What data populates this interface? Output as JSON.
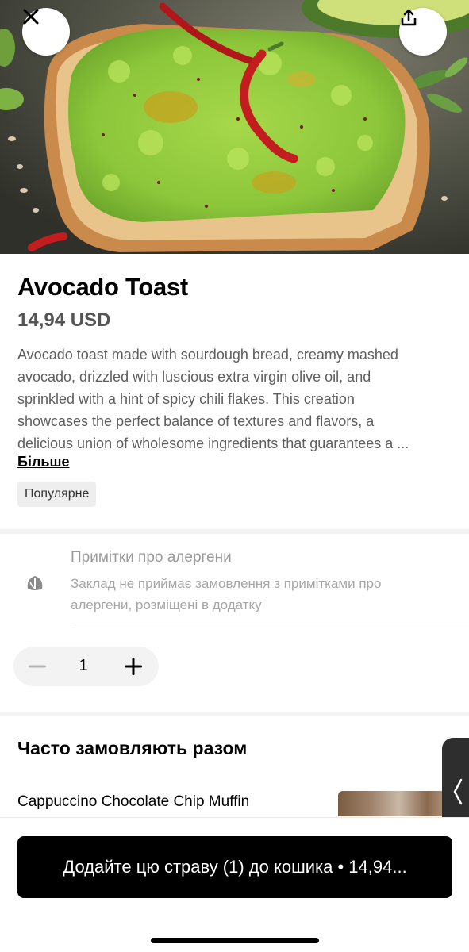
{
  "header": {
    "close_icon": "close-icon",
    "share_icon": "share-icon"
  },
  "item": {
    "title": "Avocado Toast",
    "price": "14,94 USD",
    "description_lines": [
      "Avocado toast made with sourdough bread, creamy mashed",
      "avocado, drizzled with luscious extra virgin olive oil, and",
      "sprinkled with a hint of spicy chili flakes. This creation",
      "showcases the perfect balance of textures and flavors, a",
      "delicious union of wholesome ingredients that guarantees a ..."
    ],
    "more_label": "Більше",
    "badge": "Популярне"
  },
  "allergen": {
    "icon": "leaf-icon",
    "title": "Примітки про алергени",
    "text": "Заклад не приймає замовлення з примітками про алергени, розміщені в додатку"
  },
  "stepper": {
    "quantity": "1",
    "minus_icon": "minus-icon",
    "plus_icon": "plus-icon"
  },
  "frequently_ordered": {
    "title": "Часто замовляють разом",
    "items": [
      {
        "name": "Cappuccino Chocolate Chip Muffin"
      }
    ]
  },
  "cta": {
    "label": "Додайте цю страву (1) до кошика • 14,94..."
  },
  "colors": {
    "primary_button": "#000000",
    "price_text": "#545454",
    "badge_bg": "#eeeeee"
  }
}
